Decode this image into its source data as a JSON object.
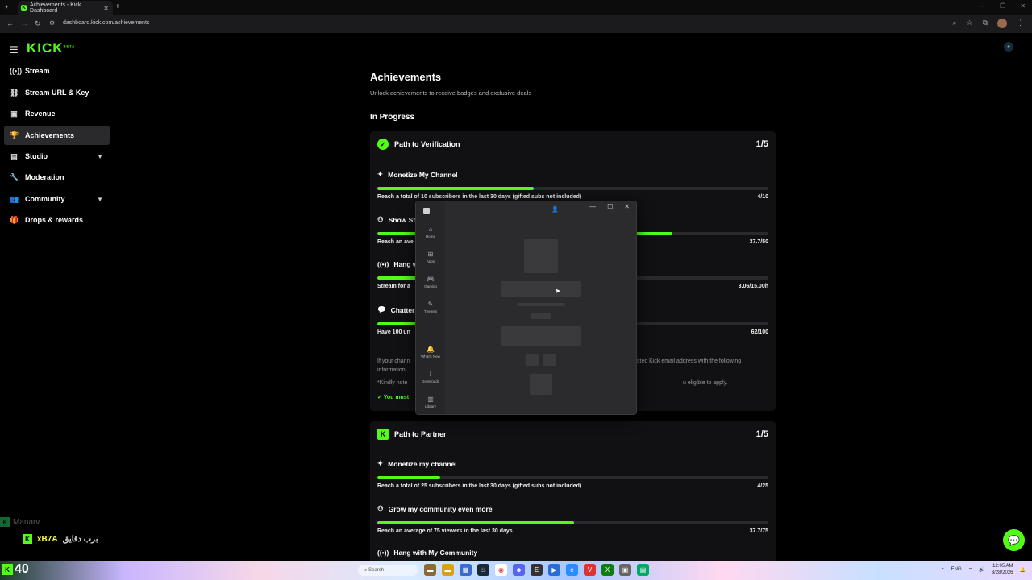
{
  "browser": {
    "tab_title": "Achievements - Kick Dashboard",
    "url": "dashboard.kick.com/achievements"
  },
  "sidebar": {
    "logo": "KICK",
    "logo_sup": "BETA",
    "items": [
      {
        "label": "Stream",
        "icon": "broadcast-icon"
      },
      {
        "label": "Stream URL & Key",
        "icon": "link-icon"
      },
      {
        "label": "Revenue",
        "icon": "revenue-icon"
      },
      {
        "label": "Achievements",
        "icon": "trophy-icon"
      },
      {
        "label": "Studio",
        "icon": "studio-icon"
      },
      {
        "label": "Moderation",
        "icon": "wrench-icon"
      },
      {
        "label": "Community",
        "icon": "people-icon"
      },
      {
        "label": "Drops & rewards",
        "icon": "gift-icon"
      }
    ]
  },
  "main": {
    "title": "Achievements",
    "subtitle": "Unlock achievements to receive badges and exclusive deals",
    "section": "In Progress",
    "verification": {
      "title": "Path to Verification",
      "count": "1/5",
      "tasks": [
        {
          "title": "Monetize My Channel",
          "desc": "Reach a total of 10 subscribers in the last 30 days (gifted subs not included)",
          "value": "4/10",
          "progress": 0.4
        },
        {
          "title": "Show St",
          "desc": "Reach an ave",
          "value": "37.7/50",
          "progress": 0.754
        },
        {
          "title": "Hang wi",
          "desc": "Stream for a",
          "value": "3.06/15.00h",
          "progress": 0.204
        },
        {
          "title": "Chatter",
          "desc": "Have 100 un",
          "value": "62/100",
          "progress": 0.62
        }
      ],
      "note_left": "If your chann",
      "note_right": "sted Kick email address with the following",
      "note2": "information:",
      "note3_left": "*Kindly note",
      "note3_right": "u eligible to apply.",
      "note4": "You must"
    },
    "partner": {
      "title": "Path to Partner",
      "count": "1/5",
      "tasks": [
        {
          "title": "Monetize my channel",
          "desc": "Reach a total of 25 subscribers in the last 30 days (gifted subs not included)",
          "value": "4/25",
          "progress": 0.16
        },
        {
          "title": "Grow my community even more",
          "desc": "Reach an average of 75 viewers in the last 30 days",
          "value": "37.7/75",
          "progress": 0.503
        },
        {
          "title": "Hang with My Community"
        }
      ]
    }
  },
  "dialog": {
    "rail": [
      "Home",
      "Apps",
      "Gaming",
      "Themes",
      "What's New",
      "Downloads",
      "Library"
    ]
  },
  "overlay": {
    "line1": "Manarv",
    "line2_name": "xB7A",
    "line2_text": "برب دقايق"
  },
  "taskbar": {
    "number": "40",
    "search": "Search",
    "lang": "ENG",
    "time": "12:05 AM",
    "date": "3/28/2026"
  }
}
